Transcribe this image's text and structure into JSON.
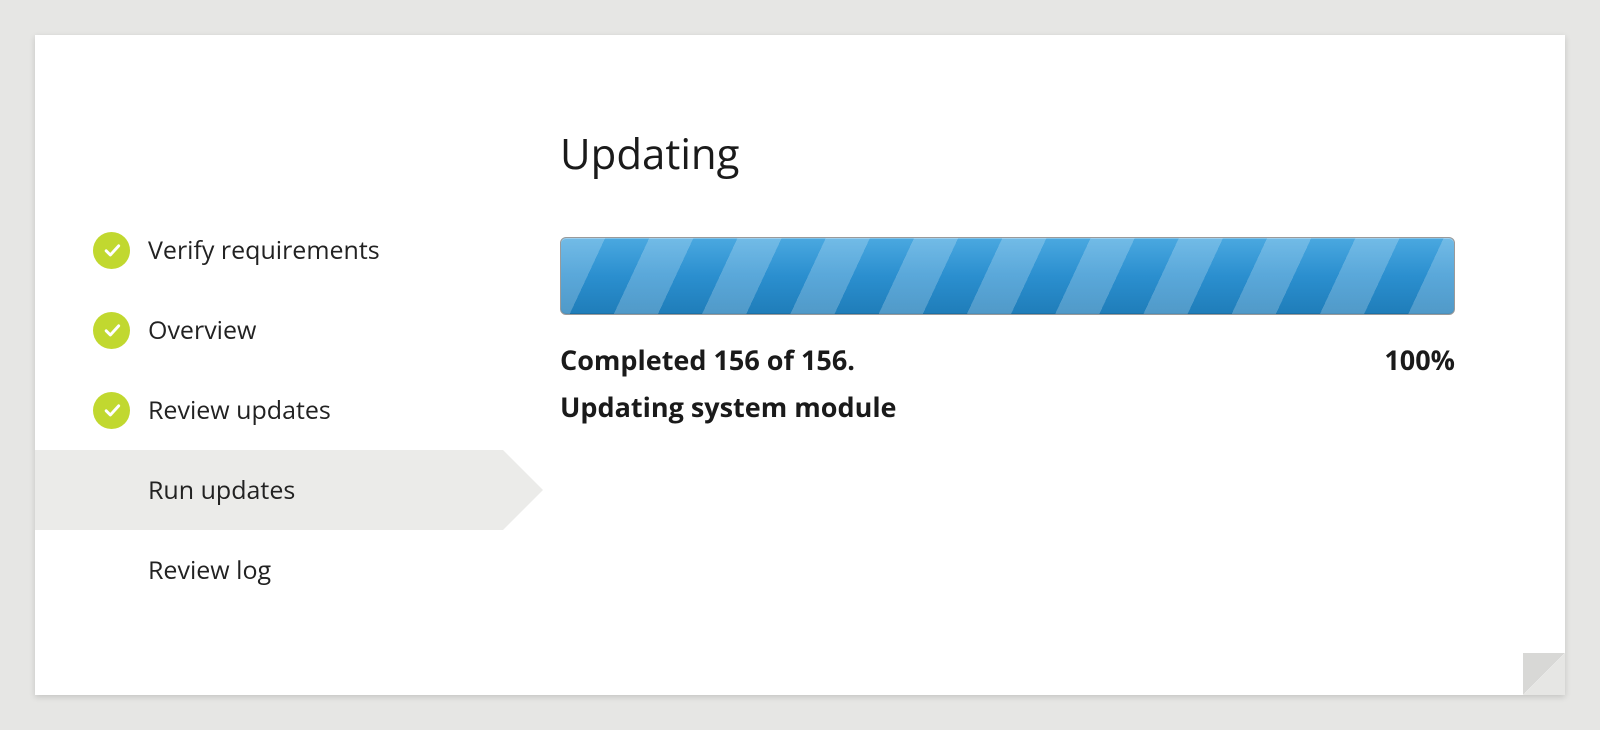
{
  "page": {
    "title": "Updating"
  },
  "steps": [
    {
      "label": "Verify requirements",
      "state": "done"
    },
    {
      "label": "Overview",
      "state": "done"
    },
    {
      "label": "Review updates",
      "state": "done"
    },
    {
      "label": "Run updates",
      "state": "active"
    },
    {
      "label": "Review log",
      "state": "pending"
    }
  ],
  "progress": {
    "completed_text": "Completed 156 of 156.",
    "percent_text": "100%",
    "status_text": "Updating system module",
    "percent_value": 100
  }
}
